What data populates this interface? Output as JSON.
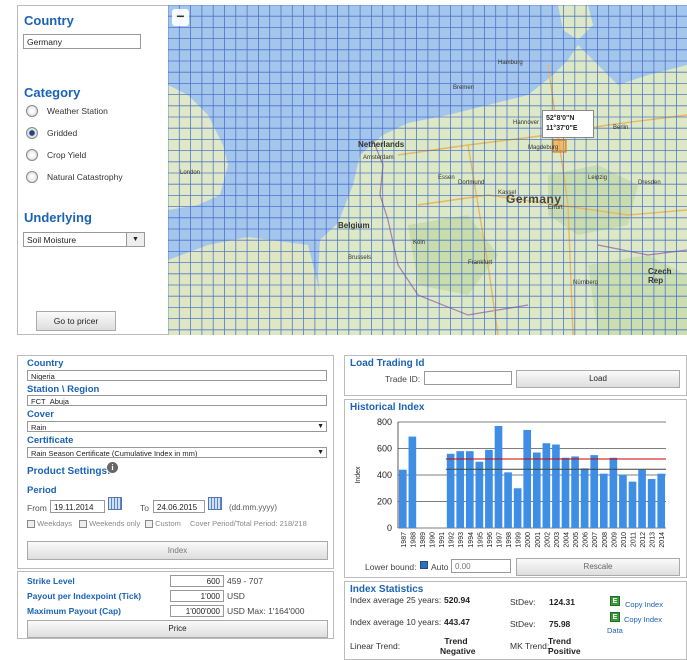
{
  "top": {
    "country_title": "Country",
    "country_value": "Germany",
    "category_title": "Category",
    "categories": [
      {
        "label": "Weather Station",
        "selected": false
      },
      {
        "label": "Gridded",
        "selected": true
      },
      {
        "label": "Crop Yield",
        "selected": false
      },
      {
        "label": "Natural Catastrophy",
        "selected": false
      }
    ],
    "underlying_title": "Underlying",
    "underlying_value": "Soil Moisture",
    "go_button": "Go to pricer"
  },
  "map": {
    "zoom_out": "−",
    "coord_lat": "52°8'0\"N",
    "coord_lon": "11°37'0\"E",
    "labels": {
      "netherlands": "Netherlands",
      "belgium": "Belgium",
      "germany": "Germany",
      "czech": "Czech Rep",
      "amsterdam": "Amsterdam",
      "cities": [
        "Hamburg",
        "Bremen",
        "Hannover",
        "Berlin",
        "Leipzig",
        "Dresden",
        "Köln",
        "Frankfurt",
        "Nürnberg",
        "Brussels",
        "London",
        "Essen",
        "Dortmund",
        "Magdeburg",
        "Kassel",
        "Erfurt"
      ]
    },
    "colors": {
      "sea": "#a5c6ec",
      "land": "#dde8c6",
      "grid": "#4a75c8",
      "highlight": "#f0a040"
    }
  },
  "form": {
    "country_label": "Country",
    "country_value": "Nigeria",
    "station_label": "Station \\ Region",
    "station_value": "FCT_Abuja",
    "cover_label": "Cover",
    "cover_value": "Rain",
    "certificate_label": "Certificate",
    "certificate_value": "Rain Season Certificate (Cumulative Index in mm)",
    "product_settings": "Product Settings:",
    "period_label": "Period",
    "from_label": "From",
    "from_value": "19.11.2014",
    "to_label": "To",
    "to_value": "24.06.2015",
    "date_format": "(dd.mm.yyyy)",
    "weekdays": "Weekdays",
    "weekends": "Weekends only",
    "custom": "Custom",
    "cover_period": "Cover Period/Total Period: 218/218",
    "index_button": "Index"
  },
  "pricing": {
    "strike_label": "Strike Level",
    "strike_value": "600",
    "strike_range": "459 - 707",
    "payout_label": "Payout per Indexpoint (Tick)",
    "payout_value": "1'000",
    "payout_unit": "USD",
    "max_label": "Maximum Payout (Cap)",
    "max_value": "1'000'000",
    "max_note": "USD Max: 1'164'000",
    "price_button": "Price"
  },
  "load": {
    "title": "Load Trading Id",
    "trade_label": "Trade ID:",
    "trade_value": "",
    "load_button": "Load"
  },
  "historical": {
    "title": "Historical Index",
    "lower_bound_label": "Lower bound:",
    "auto_label": "Auto",
    "lower_value": "0.00",
    "rescale_button": "Rescale"
  },
  "chart_data": {
    "type": "bar",
    "title": "",
    "ylabel": "Index",
    "ylim": [
      0,
      800
    ],
    "yticks": [
      0,
      200,
      400,
      600,
      800
    ],
    "categories": [
      "1987",
      "1988",
      "1989",
      "1990",
      "1991",
      "1992",
      "1993",
      "1994",
      "1995",
      "1996",
      "1997",
      "1998",
      "1999",
      "2000",
      "2001",
      "2002",
      "2003",
      "2004",
      "2005",
      "2006",
      "2007",
      "2008",
      "2009",
      "2010",
      "2011",
      "2012",
      "2013",
      "2014"
    ],
    "values": [
      440,
      690,
      null,
      null,
      null,
      560,
      580,
      580,
      500,
      590,
      770,
      420,
      300,
      740,
      570,
      640,
      630,
      530,
      540,
      450,
      550,
      410,
      530,
      400,
      350,
      440,
      370,
      410
    ],
    "reference_lines": [
      {
        "value": 520.94,
        "color": "#cc0000"
      },
      {
        "value": 443.47,
        "color": "#444444"
      }
    ],
    "bar_color": "#3f8ee6",
    "grid": true
  },
  "stats": {
    "title": "Index Statistics",
    "avg25_label": "Index average 25 years:",
    "avg25_value": "520.94",
    "sd1_label": "StDev:",
    "sd1_value": "124.31",
    "avg10_label": "Index average 10 years:",
    "avg10_value": "443.47",
    "sd2_label": "StDev:",
    "sd2_value": "75.98",
    "copy_index": "Copy Index",
    "copy_data_1": "Copy Index",
    "copy_data_2": "Data",
    "trend_label": "Linear Trend:",
    "trend_value_1": "Trend",
    "trend_value_2": "Negative",
    "mk_label": "MK Trend:",
    "mk_value_1": "Trend",
    "mk_value_2": "Positive"
  }
}
